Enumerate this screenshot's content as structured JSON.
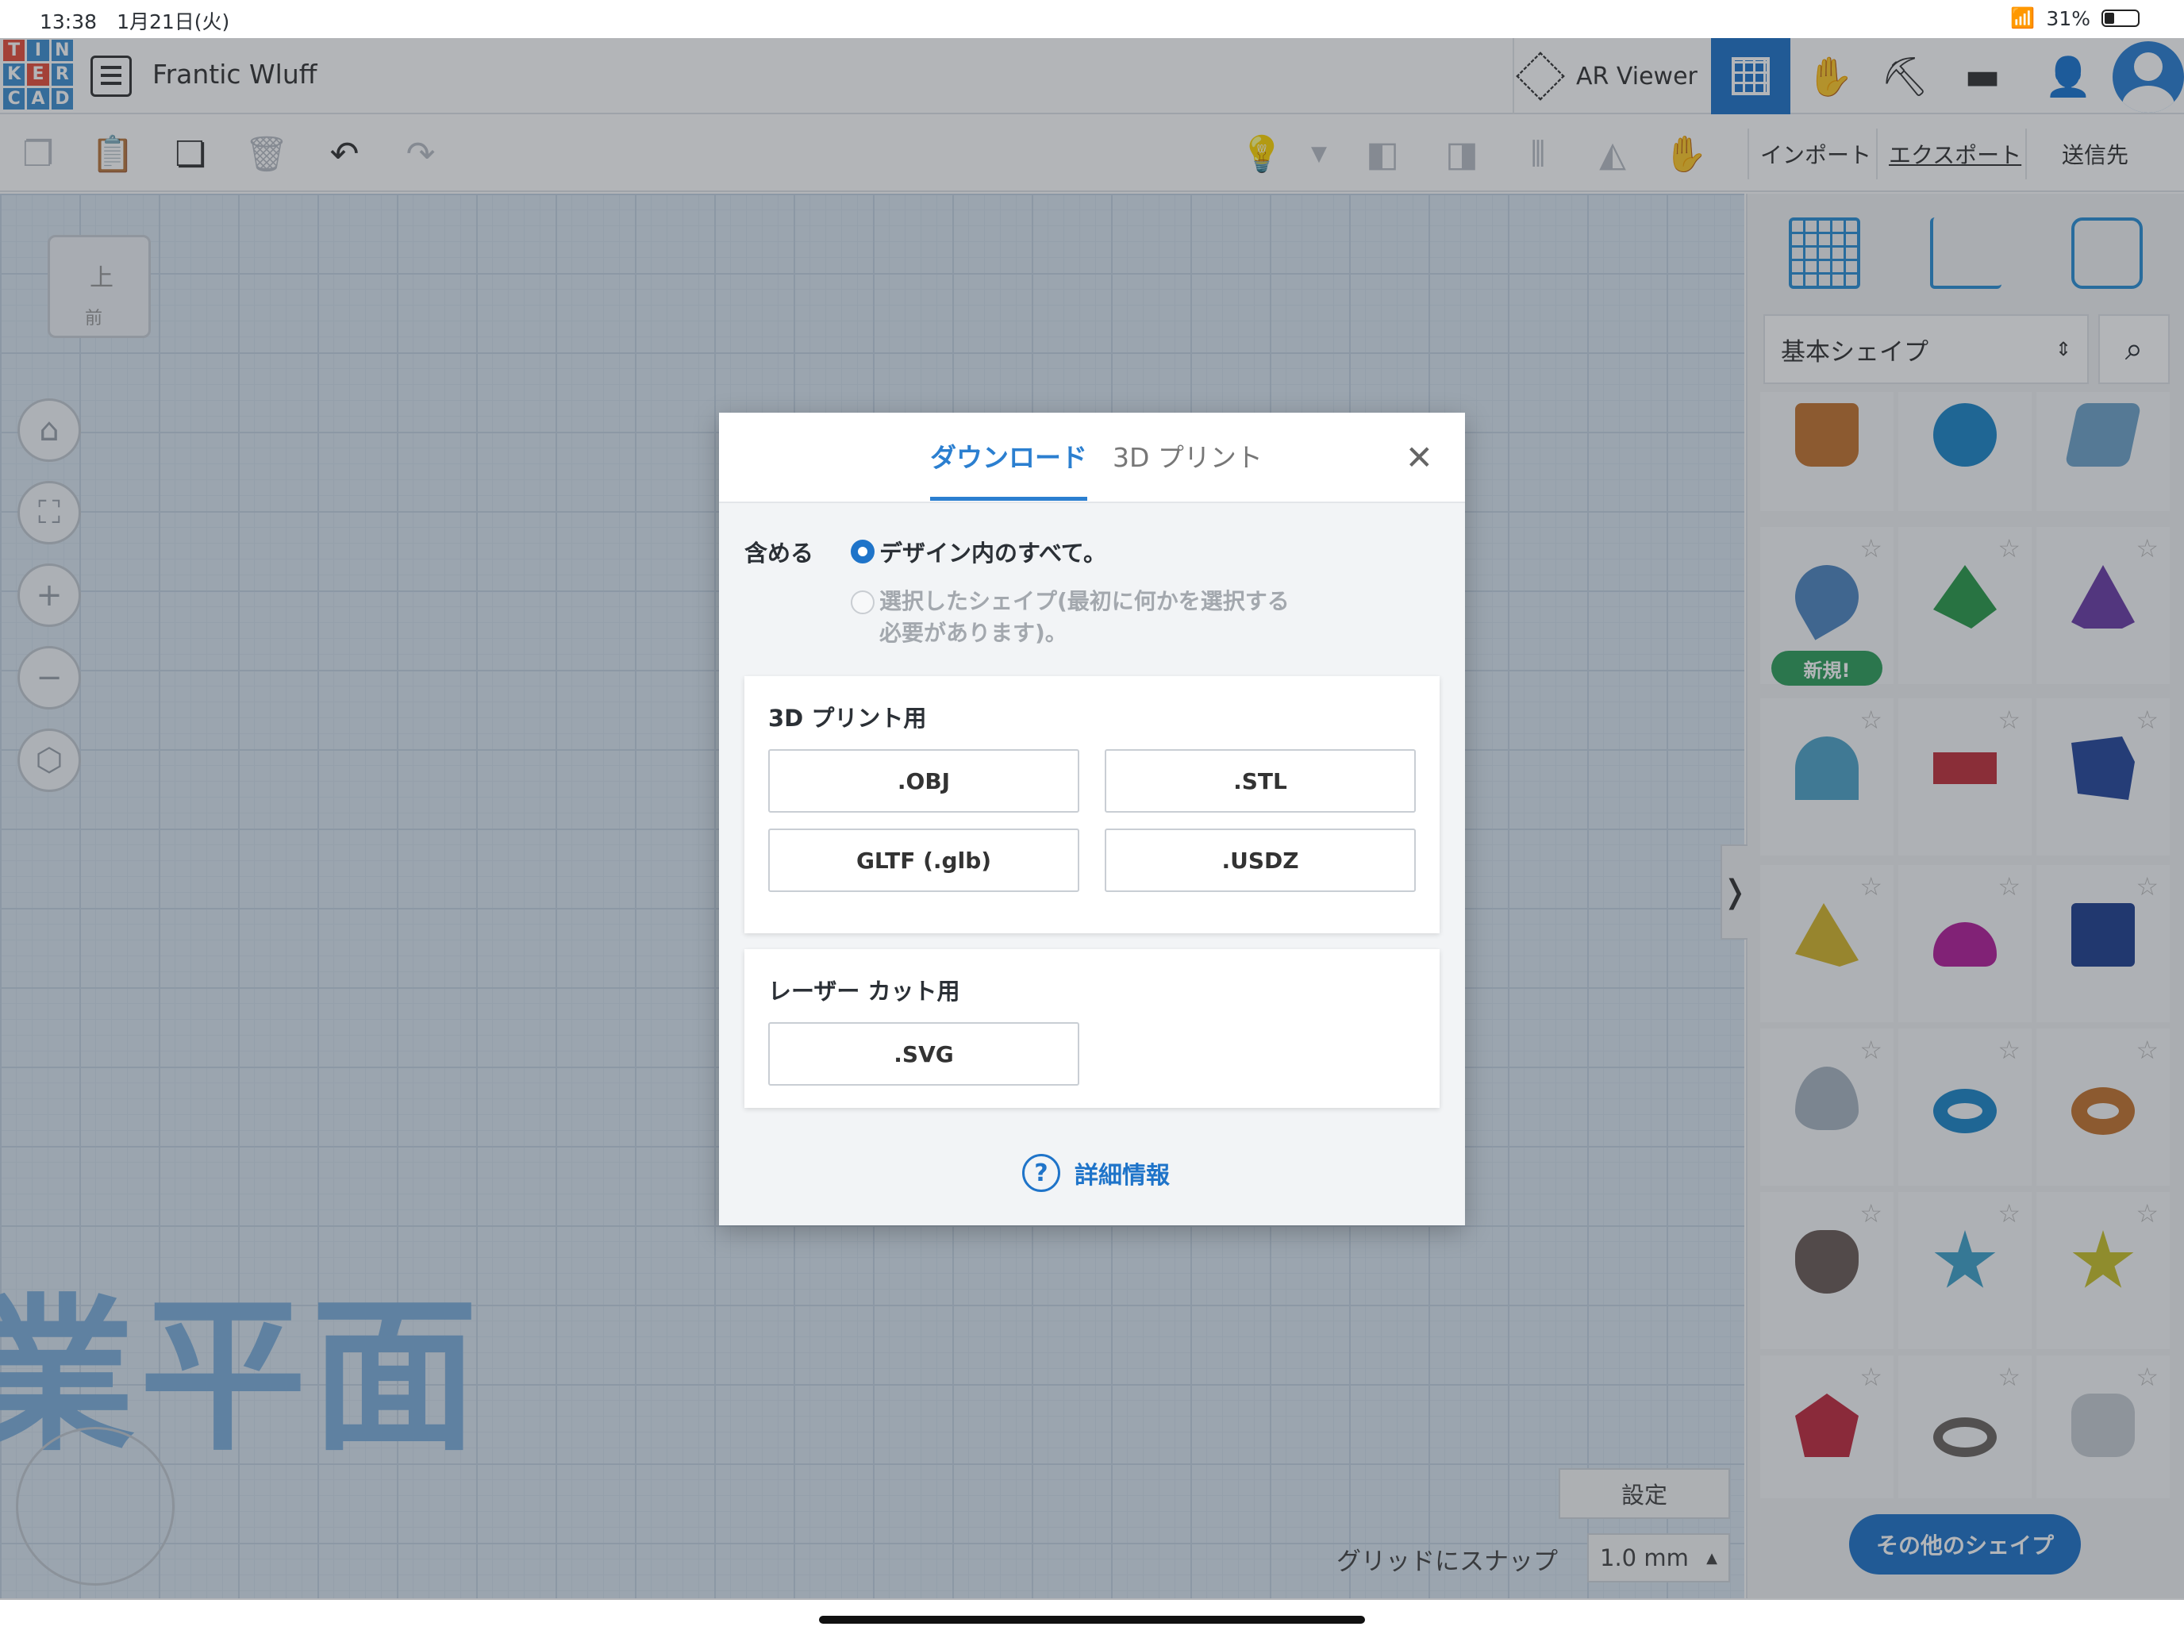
{
  "status_bar": {
    "time": "13:38",
    "date": "1月21日(火)",
    "battery": "31%"
  },
  "header": {
    "logo_letters": [
      "T",
      "I",
      "N",
      "K",
      "E",
      "R",
      "C",
      "A",
      "D"
    ],
    "logo_colors": [
      "#e64e3b",
      "#3e8fd1",
      "#3e8fd1",
      "#3e8fd1",
      "#e64e3b",
      "#3e8fd1",
      "#3e8fd1",
      "#3e8fd1",
      "#3e8fd1"
    ],
    "project_title": "Frantic Wluff",
    "ar_viewer_label": "AR Viewer"
  },
  "toolbar": {
    "import_label": "インポート",
    "export_label": "エクスポート",
    "send_label": "送信先"
  },
  "workplane": {
    "label": "業平面",
    "viewcube_top": "上",
    "viewcube_front": "前",
    "settings_label": "設定",
    "snap_label": "グリッドにスナップ",
    "snap_value": "1.0 mm"
  },
  "panel": {
    "category": "基本シェイプ",
    "new_badge": "新規!",
    "more_shapes": "その他のシェイプ"
  },
  "modal": {
    "tabs": [
      "ダウンロード",
      "3D プリント"
    ],
    "include_label": "含める",
    "option_all": "デザイン内のすべて。",
    "option_selected": "選択したシェイプ(最初に何かを選択する必要があります)。",
    "print_section_title": "3D プリント用",
    "print_formats": [
      ".OBJ",
      ".STL",
      "GLTF (.glb)",
      ".USDZ"
    ],
    "laser_section_title": "レーザー カット用",
    "laser_formats": [
      ".SVG"
    ],
    "help_label": "詳細情報"
  },
  "accent_color": "#1f74c9"
}
